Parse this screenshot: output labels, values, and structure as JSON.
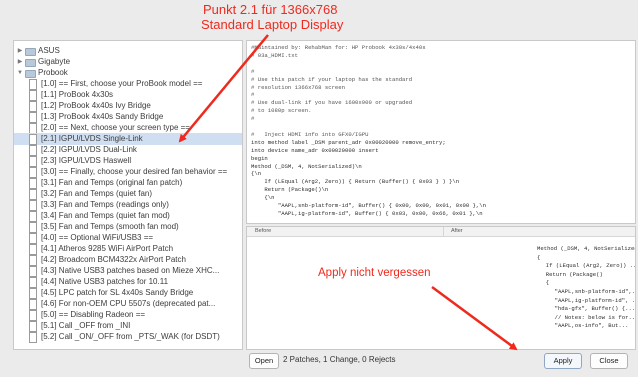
{
  "annotations": {
    "top_line1": "Punkt 2.1 für 1366x768",
    "top_line2": "Standard Laptop Display",
    "apply_note": "Apply nicht vergessen"
  },
  "tree": [
    {
      "type": "folder",
      "indent": 0,
      "label": "ASUS",
      "expanded": false
    },
    {
      "type": "folder",
      "indent": 0,
      "label": "Gigabyte",
      "expanded": false
    },
    {
      "type": "folder",
      "indent": 0,
      "label": "Probook",
      "expanded": true
    },
    {
      "type": "doc",
      "indent": 1,
      "label": "[1.0] == First, choose your ProBook model =="
    },
    {
      "type": "doc",
      "indent": 1,
      "label": "[1.1] ProBook 4x30s"
    },
    {
      "type": "doc",
      "indent": 1,
      "label": "[1.2] ProBook 4x40s Ivy Bridge"
    },
    {
      "type": "doc",
      "indent": 1,
      "label": "[1.3] ProBook 4x40s Sandy Bridge"
    },
    {
      "type": "doc",
      "indent": 1,
      "label": "[2.0] == Next, choose your screen type =="
    },
    {
      "type": "doc",
      "indent": 1,
      "label": "[2.1] IGPU/LVDS Single-Link",
      "selected": true
    },
    {
      "type": "doc",
      "indent": 1,
      "label": "[2.2] IGPU/LVDS Dual-Link"
    },
    {
      "type": "doc",
      "indent": 1,
      "label": "[2.3] IGPU/LVDS Haswell"
    },
    {
      "type": "doc",
      "indent": 1,
      "label": "[3.0] == Finally, choose your desired fan behavior =="
    },
    {
      "type": "doc",
      "indent": 1,
      "label": "[3.1] Fan and Temps (original fan patch)"
    },
    {
      "type": "doc",
      "indent": 1,
      "label": "[3.2] Fan and Temps (quiet fan)"
    },
    {
      "type": "doc",
      "indent": 1,
      "label": "[3.3] Fan and Temps (readings only)"
    },
    {
      "type": "doc",
      "indent": 1,
      "label": "[3.4] Fan and Temps (quiet fan mod)"
    },
    {
      "type": "doc",
      "indent": 1,
      "label": "[3.5] Fan and Temps (smooth fan mod)"
    },
    {
      "type": "doc",
      "indent": 1,
      "label": "[4.0] == Optional WiFi/USB3 =="
    },
    {
      "type": "doc",
      "indent": 1,
      "label": "[4.1] Atheros 9285 WiFi AirPort Patch"
    },
    {
      "type": "doc",
      "indent": 1,
      "label": "[4.2] Broadcom BCM4322x AirPort Patch"
    },
    {
      "type": "doc",
      "indent": 1,
      "label": "[4.3] Native USB3 patches based on Mieze XHC..."
    },
    {
      "type": "doc",
      "indent": 1,
      "label": "[4.4] Native USB3 patches for 10.11"
    },
    {
      "type": "doc",
      "indent": 1,
      "label": "[4.5] LPC patch for SL 4x40s Sandy Bridge"
    },
    {
      "type": "doc",
      "indent": 1,
      "label": "[4.6] For non-OEM CPU 5507s (deprecated pat..."
    },
    {
      "type": "doc",
      "indent": 1,
      "label": "[5.0] == Disabling Radeon =="
    },
    {
      "type": "doc",
      "indent": 1,
      "label": "[5.1] Call _OFF from _INI"
    },
    {
      "type": "doc",
      "indent": 1,
      "label": "[5.2] Call _ON/_OFF from _PTS/_WAK (for DSDT)"
    }
  ],
  "code": [
    {
      "t": "#Maintained by: RehabMan for: HP Probook 4x30s/4x40s",
      "c": true
    },
    {
      "t": "# 03a_HDMI.txt",
      "c": true
    },
    {
      "t": ""
    },
    {
      "t": "#",
      "c": true
    },
    {
      "t": "# Use this patch if your laptop has the standard",
      "c": true
    },
    {
      "t": "# resolution 1366x768 screen",
      "c": true
    },
    {
      "t": "#",
      "c": true
    },
    {
      "t": "# Use dual-link if you have 1600x900 or upgraded",
      "c": true
    },
    {
      "t": "# to 1080p screen.",
      "c": true
    },
    {
      "t": "#",
      "c": true
    },
    {
      "t": ""
    },
    {
      "t": "#   Inject HDMI info into GFX0/IGPU",
      "c": true
    },
    {
      "t": "into method label _DSM parent_adr 0x00020000 remove_entry;"
    },
    {
      "t": "into device name_adr 0x00020000 insert"
    },
    {
      "t": "begin"
    },
    {
      "t": "Method (_DSM, 4, NotSerialized)\\n"
    },
    {
      "t": "{\\n"
    },
    {
      "t": "    If (LEqual (Arg2, Zero)) { Return (Buffer() { 0x03 } ) }\\n"
    },
    {
      "t": "    Return (Package()\\n"
    },
    {
      "t": "    {\\n"
    },
    {
      "t": "        \"AAPL,snb-platform-id\", Buffer() { 0x00, 0x00, 0x01, 0x00 },\\n"
    },
    {
      "t": "        \"AAPL,ig-platform-id\", Buffer() { 0x03, 0x00, 0x66, 0x01 },\\n"
    }
  ],
  "diff_labels": {
    "before": "Before",
    "after": "After"
  },
  "after_lines": [
    "Method (_DSM, 4, NotSerialized)",
    "{",
    "    If (LEqual (Arg2, Zero)) ...",
    "    Return (Package()",
    "    {",
    "        \"AAPL,snb-platform-id\",...",
    "        \"AAPL,ig-platform-id\", ...",
    "        \"hda-gfx\", Buffer() {...",
    "        // Notes: below is for...",
    "        \"AAPL,os-info\", But..."
  ],
  "bottom": {
    "open_label": "Open",
    "status": "2 Patches, 1 Change, 0 Rejects",
    "apply_label": "Apply",
    "close_label": "Close"
  },
  "colors": {
    "annotation": "#ee2a1e",
    "selection": "#cfdef0"
  }
}
